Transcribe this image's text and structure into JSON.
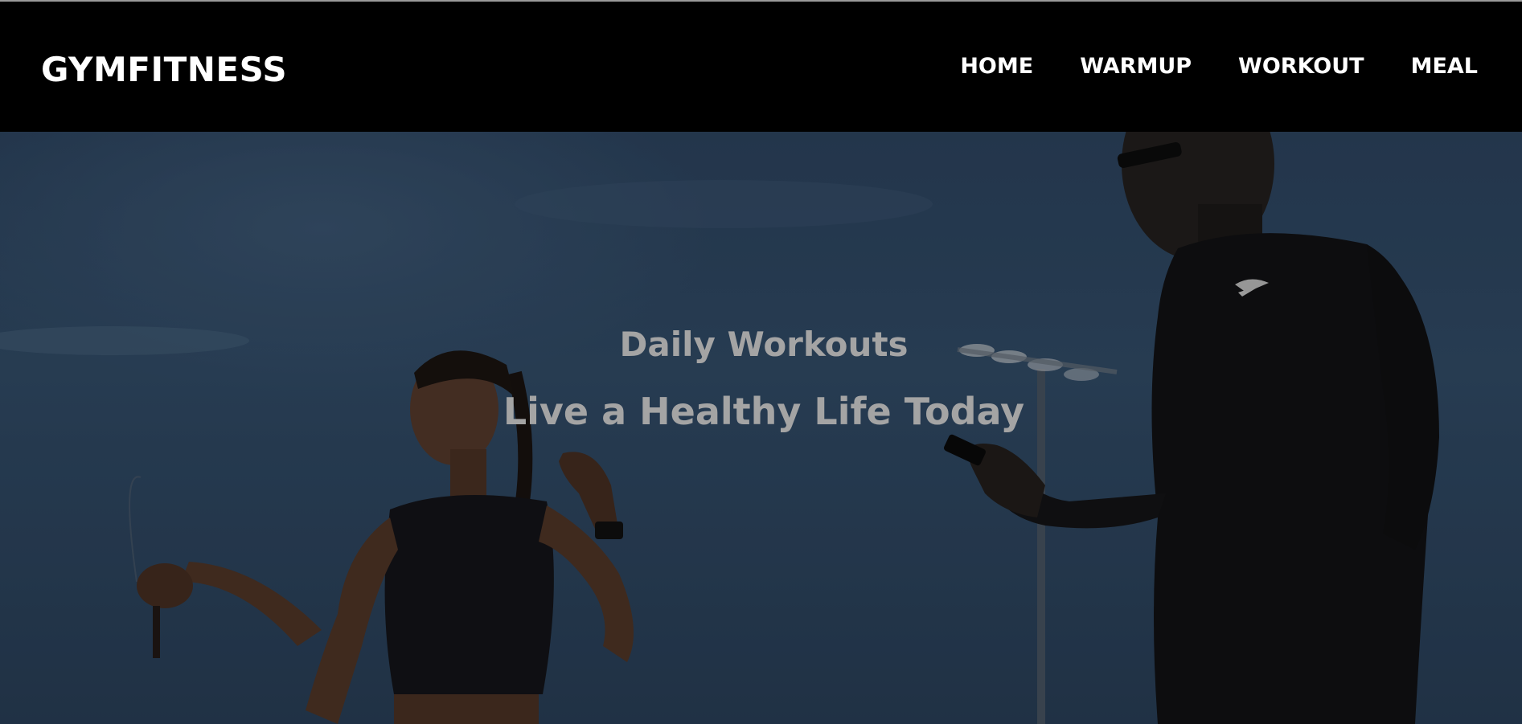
{
  "brand": {
    "name": "GYMFITNESS"
  },
  "nav": {
    "items": [
      {
        "label": "HOME"
      },
      {
        "label": "WARMUP"
      },
      {
        "label": "WORKOUT"
      },
      {
        "label": "MEAL"
      }
    ]
  },
  "hero": {
    "subtitle": "Daily Workouts",
    "title": "Live a Healthy Life Today",
    "background_image": "woman-jumping-rope-and-man-with-phone"
  },
  "colors": {
    "header_bg": "#000000",
    "nav_text": "#ffffff",
    "hero_text": "#a4a4a4",
    "sky": "#34506d"
  }
}
